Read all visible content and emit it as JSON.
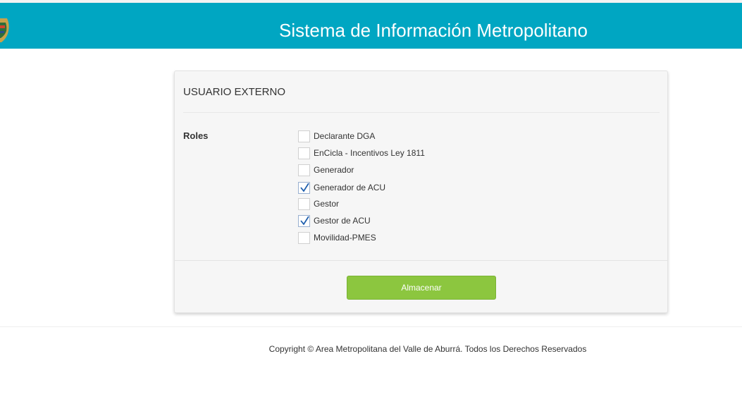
{
  "header": {
    "title": "Sistema de Información Metropolitano",
    "background_color": "#00a6c2",
    "logo_icon": "coat-of-arms-icon"
  },
  "form": {
    "title": "USUARIO EXTERNO",
    "roles_label": "Roles",
    "roles": [
      {
        "label": "Declarante DGA",
        "checked": false
      },
      {
        "label": "EnCicla - Incentivos Ley 1811",
        "checked": false
      },
      {
        "label": "Generador",
        "checked": false
      },
      {
        "label": "Generador de ACU",
        "checked": true
      },
      {
        "label": "Gestor",
        "checked": false
      },
      {
        "label": "Gestor de ACU",
        "checked": true
      },
      {
        "label": "Movilidad-PMES",
        "checked": false
      }
    ],
    "save_label": "Almacenar",
    "save_color": "#8cc63f"
  },
  "footer": {
    "copyright": "Copyright © Area Metropolitana del Valle de Aburrá. Todos los Derechos Reservados"
  }
}
